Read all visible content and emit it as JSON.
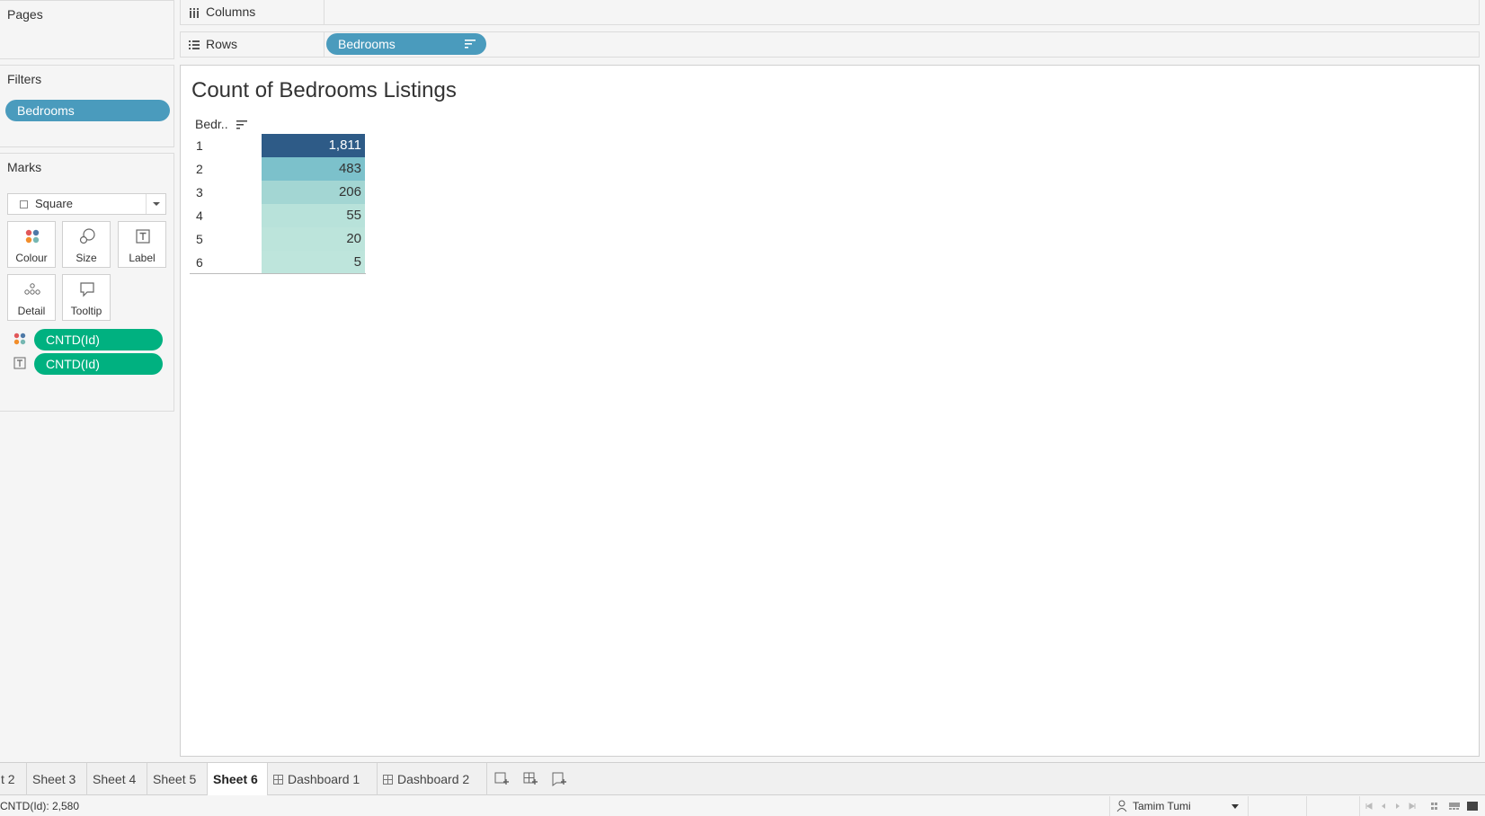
{
  "panels": {
    "pages_title": "Pages",
    "filters_title": "Filters",
    "marks_title": "Marks"
  },
  "filters": {
    "pill": "Bedrooms"
  },
  "marks": {
    "mark_type": "Square",
    "buttons": {
      "colour": "Colour",
      "size": "Size",
      "label": "Label",
      "detail": "Detail",
      "tooltip": "Tooltip"
    },
    "fields": [
      {
        "role": "colour",
        "name": "CNTD(Id)"
      },
      {
        "role": "label",
        "name": "CNTD(Id)"
      }
    ]
  },
  "shelves": {
    "columns_label": "Columns",
    "rows_label": "Rows",
    "rows_pill": "Bedrooms"
  },
  "viz": {
    "title": "Count of Bedrooms Listings",
    "column_header": "Bedr..",
    "rows": [
      {
        "label": "1",
        "value": "1,811",
        "color": "#2e5b87"
      },
      {
        "label": "2",
        "value": "483",
        "color": "#7cc1cb"
      },
      {
        "label": "3",
        "value": "206",
        "color": "#a3d6d3"
      },
      {
        "label": "4",
        "value": "55",
        "color": "#b8e2da"
      },
      {
        "label": "5",
        "value": "20",
        "color": "#bce4db"
      },
      {
        "label": "6",
        "value": "5",
        "color": "#bee5dc"
      }
    ]
  },
  "tabs": {
    "items": [
      "t 2",
      "Sheet 3",
      "Sheet 4",
      "Sheet 5",
      "Sheet 6",
      "Dashboard 1",
      "Dashboard 2"
    ],
    "active": "Sheet 6"
  },
  "status": {
    "summary": "CNTD(Id): 2,580",
    "user": "Tamim Tumi"
  },
  "colors": {
    "pill_blue": "#4a9bbd",
    "pill_green": "#00b180"
  }
}
